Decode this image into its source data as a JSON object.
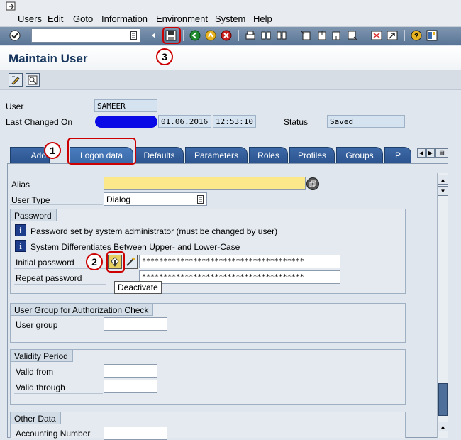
{
  "menu": {
    "items": [
      "Users",
      "Edit",
      "Goto",
      "Information",
      "Environment",
      "System",
      "Help"
    ]
  },
  "toolbar": {
    "command_field_value": ""
  },
  "title": "Maintain User",
  "header": {
    "user_label": "User",
    "user_value": "SAMEER",
    "last_changed_label": "Last Changed On",
    "last_changed_date": "01.06.2016",
    "last_changed_time": "12:53:10",
    "status_label": "Status",
    "status_value": "Saved"
  },
  "tabs": [
    {
      "label": "Add"
    },
    {
      "label": "Logon data"
    },
    {
      "label": "Defaults"
    },
    {
      "label": "Parameters"
    },
    {
      "label": "Roles"
    },
    {
      "label": "Profiles"
    },
    {
      "label": "Groups"
    },
    {
      "label": "P"
    }
  ],
  "logon": {
    "alias_label": "Alias",
    "alias_value": "",
    "user_type_label": "User Type",
    "user_type_value": "Dialog",
    "password_group": "Password",
    "info1": "Password set by system administrator (must be changed by user)",
    "info2": "System Differentiates Between Upper- and Lower-Case",
    "initial_password_label": "Initial password",
    "initial_password_value": "**************************************",
    "repeat_password_label": "Repeat password",
    "repeat_password_value": "**************************************",
    "tooltip": "Deactivate",
    "auth_group": "User Group for Authorization Check",
    "user_group_label": "User group",
    "user_group_value": "",
    "validity_group": "Validity Period",
    "valid_from_label": "Valid from",
    "valid_from_value": "",
    "valid_through_label": "Valid through",
    "valid_through_value": "",
    "other_group": "Other Data",
    "accounting_label": "Accounting Number",
    "accounting_value": ""
  },
  "annotations": [
    "1",
    "2",
    "3"
  ],
  "colors": {
    "accent": "#2c5590",
    "annotation": "#cc0000",
    "required": "#fbe88a"
  }
}
